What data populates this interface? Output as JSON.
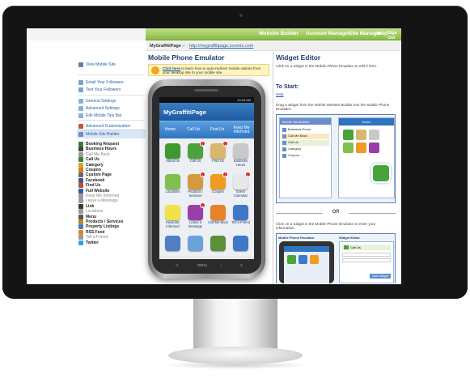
{
  "topnav": [
    "Website Builder",
    "Account Manager",
    "Site Manager",
    "Help",
    "Sign Out"
  ],
  "breadcrumb": {
    "site": "MyGraffitiPage",
    "url": "http://mygraffitipage.zoomie.com"
  },
  "sidebar": {
    "group1": [
      {
        "label": "View Mobile Site",
        "icon": "monitor-icon"
      }
    ],
    "group2": [
      {
        "label": "Email Your Followers",
        "icon": "email-icon"
      },
      {
        "label": "Text Your Followers",
        "icon": "text-message-icon"
      }
    ],
    "group3": [
      {
        "label": "General Settings",
        "icon": "settings-icon"
      },
      {
        "label": "Advanced Settings",
        "icon": "advanced-settings-icon"
      },
      {
        "label": "Edit Mobile Tips Bar",
        "icon": "tips-bar-icon"
      }
    ],
    "group4": [
      {
        "label": "Advanced Customization",
        "icon": "palette-icon"
      }
    ],
    "section_header": "Mobile Site Builder",
    "widgets": [
      {
        "label": "Booking Request",
        "style": "bold",
        "icon": "calendar-icon",
        "color": "#3d7a2e"
      },
      {
        "label": "Business Hours",
        "style": "bold",
        "icon": "clock-icon",
        "color": "#444444"
      },
      {
        "label": "Call Me Back",
        "style": "gray",
        "icon": "call-me-back-icon",
        "color": "#9a9a9a"
      },
      {
        "label": "Call Us",
        "style": "bold",
        "icon": "phone-icon",
        "color": "#2f8a2f"
      },
      {
        "label": "Category",
        "style": "bold",
        "icon": "folder-icon",
        "color": "#d6a23a"
      },
      {
        "label": "Coupon",
        "style": "bold",
        "icon": "coupon-icon",
        "color": "#e07b1a"
      },
      {
        "label": "Custom Page",
        "style": "bold",
        "icon": "page-icon",
        "color": "#6a6a6a"
      },
      {
        "label": "Facebook",
        "style": "bold",
        "icon": "facebook-icon",
        "color": "#3b5998"
      },
      {
        "label": "Find Us",
        "style": "bold",
        "icon": "map-icon",
        "color": "#c84a2a"
      },
      {
        "label": "Full Website",
        "style": "bold",
        "icon": "website-icon",
        "color": "#2a62a5"
      },
      {
        "label": "Keep Me Informed",
        "style": "gray",
        "icon": "keep-informed-icon",
        "color": "#9a9a9a"
      },
      {
        "label": "Leave a Message",
        "style": "gray",
        "icon": "message-icon",
        "color": "#9a9a9a"
      },
      {
        "label": "Link",
        "style": "bold",
        "icon": "link-icon",
        "color": "#3a3a3a"
      },
      {
        "label": "Locations",
        "style": "gray",
        "icon": "locations-icon",
        "color": "#9a9a9a"
      },
      {
        "label": "Menu",
        "style": "bold",
        "icon": "menu-icon",
        "color": "#555555"
      },
      {
        "label": "Products / Services",
        "style": "bold",
        "icon": "products-icon",
        "color": "#b5882a"
      },
      {
        "label": "Property Listings",
        "style": "bold",
        "icon": "property-icon",
        "color": "#4a7ab5"
      },
      {
        "label": "RSS Feed",
        "style": "bold",
        "icon": "rss-icon",
        "color": "#e8821f"
      },
      {
        "label": "Tell a Friend",
        "style": "gray",
        "icon": "tell-friend-icon",
        "color": "#9a9a9a"
      },
      {
        "label": "Twitter",
        "style": "bold",
        "icon": "twitter-icon",
        "color": "#2aa9e0"
      }
    ]
  },
  "emulator": {
    "title": "Mobile Phone Emulator",
    "tip_link": "Click here",
    "tip_text": " to learn how to auto-redirect mobile visitors from your desktop site to your mobile site.",
    "phone": {
      "status": "10:45 AM",
      "app_title": "MyGraffitiPage",
      "nav": [
        "Home",
        "Call Us",
        "Find Us",
        "Keep Me Informed"
      ],
      "tiles": [
        {
          "label": "About Us",
          "icon": "info-icon",
          "color": "#3f9a2e",
          "badge": ""
        },
        {
          "label": "Call Us",
          "icon": "phone-icon",
          "color": "#4aa33a",
          "badge": "1"
        },
        {
          "label": "Find Us",
          "icon": "map-icon",
          "color": "#d9b76e",
          "badge": "1"
        },
        {
          "label": "Business Hours",
          "icon": "clock-icon",
          "color": "#c9c9c9",
          "badge": ""
        },
        {
          "label": "Locations",
          "icon": "locations-icon",
          "color": "#7fbf4d",
          "badge": ""
        },
        {
          "label": "Products / Services",
          "icon": "products-icon",
          "color": "#d79a3a",
          "badge": "1"
        },
        {
          "label": "Coupon",
          "icon": "coupon-icon",
          "color": "#f09b22",
          "badge": "1"
        },
        {
          "label": "Event Calendar",
          "icon": "calendar-icon",
          "color": "#e8e8e8",
          "badge": "1"
        },
        {
          "label": "Keep Me Informed",
          "icon": "keep-informed-icon",
          "color": "#f2e24a",
          "badge": ""
        },
        {
          "label": "Leave a Message",
          "icon": "message-icon",
          "color": "#9b3fa8",
          "badge": "1"
        },
        {
          "label": "Call Me Back",
          "icon": "call-me-back-icon",
          "color": "#e7822a",
          "badge": ""
        },
        {
          "label": "Tell a Friend",
          "icon": "tell-friend-icon",
          "color": "#3f78c6",
          "badge": ""
        },
        {
          "label": "",
          "icon": "partial-icon-1",
          "color": "#4f7fc2",
          "badge": ""
        },
        {
          "label": "",
          "icon": "partial-icon-2",
          "color": "#6aa3d9",
          "badge": ""
        },
        {
          "label": "",
          "icon": "partial-icon-3",
          "color": "#5b8f3a",
          "badge": ""
        },
        {
          "label": "",
          "icon": "partial-icon-4",
          "color": "#3f78c6",
          "badge": ""
        }
      ],
      "softkeys": [
        "MENU"
      ]
    }
  },
  "editor": {
    "title": "Widget Editor",
    "subtitle": "Click on a widget in the Mobile Phone Emulator to edit it here.",
    "to_start": "To Start:",
    "help": "Help",
    "step1": "Drag a widget from the Mobile Website Builder into the Mobile Phone Emulator.",
    "diagram1": {
      "header": "Mobile Site Builder",
      "phone_header": "Home",
      "items": [
        "Business Hours",
        "Call Me Back",
        "Call Us",
        "Category",
        "Coupon"
      ]
    },
    "or": "OR",
    "step2": "Click on a widget in the Mobile Phone Emulator to enter your information.",
    "diagram2": {
      "left_title": "Mobile Phone Emulator",
      "right_title": "Widget Editor",
      "right_item": "Call Us",
      "save": "Save Widget"
    }
  },
  "colors": {
    "accent_green": "#88bb46",
    "brand_blue": "#1d5aa0",
    "link_blue": "#2a62a5"
  }
}
